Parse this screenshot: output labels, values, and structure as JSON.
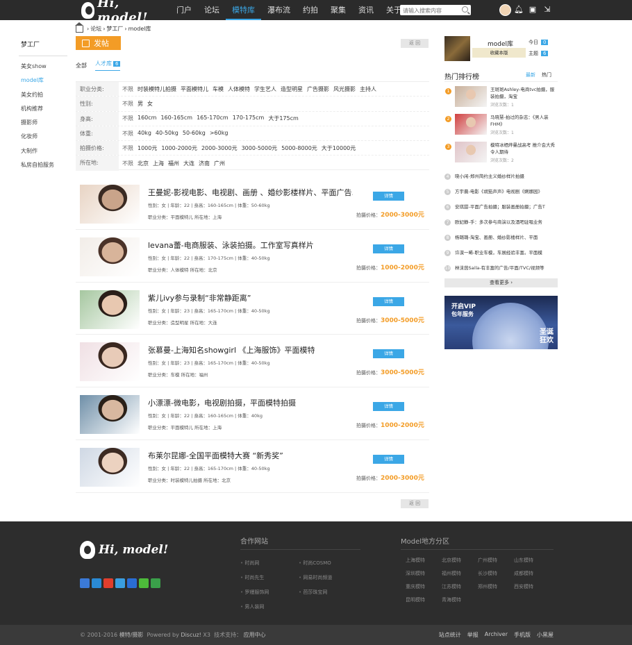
{
  "header": {
    "logo_text": "Hi, model!",
    "nav": [
      "门户",
      "论坛",
      "模特库",
      "瀑布流",
      "约拍",
      "聚集",
      "资讯",
      "关于"
    ],
    "active_nav": 2,
    "search_placeholder": "请输入搜索内容"
  },
  "breadcrumb": [
    "论坛",
    "梦工厂",
    "model库"
  ],
  "sidebar": {
    "title": "梦工厂",
    "items": [
      "美女show",
      "model库",
      "美女约拍",
      "机构推荐",
      "摄影师",
      "化妆师",
      "大制作",
      "私房自拍服务"
    ],
    "active": 1
  },
  "toolbar": {
    "post_label": "发帖",
    "back_label": "返 回"
  },
  "tabs": {
    "all": "全部",
    "talent": "人才库",
    "talent_count": "6"
  },
  "filters": [
    {
      "label": "职业分类:",
      "options": [
        "不限",
        "时装模特儿拍摄",
        "平面模特儿",
        "车模",
        "人体模特",
        "学生艺人",
        "造型明星",
        "广告摄影",
        "风光摄影",
        "主持人"
      ]
    },
    {
      "label": "性别:",
      "options": [
        "不限",
        "男",
        "女"
      ]
    },
    {
      "label": "身高:",
      "options": [
        "不限",
        "160cm",
        "160-165cm",
        "165-170cm",
        "170-175cm",
        "大于175cm"
      ]
    },
    {
      "label": "体重:",
      "options": [
        "不限",
        "40kg",
        "40-50kg",
        "50-60kg",
        ">60kg"
      ]
    },
    {
      "label": "拍摄价格:",
      "options": [
        "不限",
        "1000元",
        "1000-2000元",
        "2000-3000元",
        "3000-5000元",
        "5000-8000元",
        "大于10000元"
      ]
    },
    {
      "label": "所在地:",
      "options": [
        "不限",
        "北京",
        "上海",
        "福州",
        "大连",
        "济南",
        "广州"
      ]
    }
  ],
  "models": [
    {
      "name": "王曼妮-影视电影、电视剧、画册 、婚纱影楼样片、平面广告...",
      "meta": "性别：女 | 年龄：22 | 身高：160-165cm | 体重：50-60kg",
      "meta2": "职业分类：平面模特儿   所在地：上海",
      "detail": "详情",
      "price_label": "拍摄价格：",
      "price": "2000-3000元"
    },
    {
      "name": "levana蕾-电商服装、泳装拍摄。工作室写真样片",
      "meta": "性别：女 | 年龄：22 | 身高：170-175cm | 体重：40-50kg",
      "meta2": "职业分类：人体模特   所在地：北京",
      "detail": "详情",
      "price_label": "拍摄价格：",
      "price": "1000-2000元"
    },
    {
      "name": "紫儿ivy参与录制“非常静距离”",
      "meta": "性别：女 | 年龄：23 | 身高：165-170cm | 体重：40-50kg",
      "meta2": "职业分类：造型明星   所在地：大连",
      "detail": "详情",
      "price_label": "拍摄价格：",
      "price": "3000-5000元"
    },
    {
      "name": "张慕曼-上海知名showgirl 《上海服饰》平面模特",
      "meta": "性别：女 | 年龄：23 | 身高：165-170cm | 体重：40-50kg",
      "meta2": "职业分类：车模   所在地：福州",
      "detail": "详情",
      "price_label": "拍摄价格：",
      "price": "3000-5000元"
    },
    {
      "name": "小漂漂-微电影，电视剧拍摄，平面模特拍摄",
      "meta": "性别：女 | 年龄：22 | 身高：160-165cm | 体重：40kg",
      "meta2": "职业分类：平面模特儿   所在地：上海",
      "detail": "详情",
      "price_label": "拍摄价格：",
      "price": "1000-2000元"
    },
    {
      "name": "布莱尔昆娜-全国平面模特大赛 “新秀奖”",
      "meta": "性别：女 | 年龄：22 | 身高：165-170cm | 体重：40-50kg",
      "meta2": "职业分类：时装模特儿拍摄   所在地：北京",
      "detail": "详情",
      "price_label": "拍摄价格：",
      "price": "2000-3000元"
    }
  ],
  "right": {
    "forum_name": "model库",
    "fav_label": "收藏本版",
    "today_label": "今日",
    "today_count": "0",
    "topic_label": "主题",
    "topic_count": "6",
    "rank_title": "热门排行榜",
    "rank_tabs": [
      "最新",
      "热门"
    ],
    "rank_big": [
      {
        "num": "1",
        "title": "王斑斑Ashley-电商tvc拍摄，服装拍摄，淘宝",
        "views": "浏览次数：1"
      },
      {
        "num": "2",
        "title": "马晓慧-拍过的杂志：《男人装FHM》",
        "views": "浏览次数：1"
      },
      {
        "num": "3",
        "title": "模特冰栖烨曼战高考 推介会大秀令人期待",
        "views": "浏览次数：2"
      }
    ],
    "rank_small": [
      {
        "num": "4",
        "title": "晓小闲-郑州简约主义婚纱样片拍摄"
      },
      {
        "num": "5",
        "title": "方宇晨-电影《胡笳声声》电视剧《婀娜园》"
      },
      {
        "num": "6",
        "title": "安琪甜-平面广告拍摄；服装画册拍摄；广告T"
      },
      {
        "num": "7",
        "title": "欧妃静-手：多次参与商演以及酒吧驻唱业务"
      },
      {
        "num": "8",
        "title": "杨璐璐-淘宝、画册、婚纱影楼样片、平面"
      },
      {
        "num": "9",
        "title": "许漠一晞-职业车模，车展经验丰富。平面模"
      },
      {
        "num": "10",
        "title": "林沫茵Saila-有丰富的广告/平面/TVC/视频等"
      }
    ],
    "more_label": "查看更多",
    "ad": {
      "line1": "开启VIP",
      "line2": "包年服务",
      "line3": "圣诞",
      "line4": "狂欢"
    }
  },
  "footer": {
    "logo_text": "Hi, model!",
    "partners_title": "合作网站",
    "partners": [
      "时尚网",
      "时尚COSMO",
      "时尚先生",
      "网易时尚频道",
      "罗缦服饰网",
      "芭莎珠宝网",
      "男人装网"
    ],
    "city_title": "Model地方分区",
    "cities": [
      "上海模特",
      "北京模特",
      "广州模特",
      "山东模特",
      "深圳模特",
      "福州模特",
      "长沙模特",
      "成都模特",
      "重庆模特",
      "江苏模特",
      "郑州模特",
      "西安模特",
      "昆明模特",
      "青海模特"
    ],
    "copyright": "© 2001-2016",
    "site": "模特/摄影",
    "powered": "Powered by",
    "discuz": "Discuz!",
    "version": "X3",
    "support_label": "技术支持：",
    "support": "应用中心",
    "links": [
      "站点统计",
      "举报",
      "Archiver",
      "手机版",
      "小黑屋"
    ]
  },
  "colors": {
    "accent": "#3ba7e6",
    "orange": "#f39c26",
    "topbar": "#2b2b2b",
    "footer": "#2d2d2d"
  }
}
